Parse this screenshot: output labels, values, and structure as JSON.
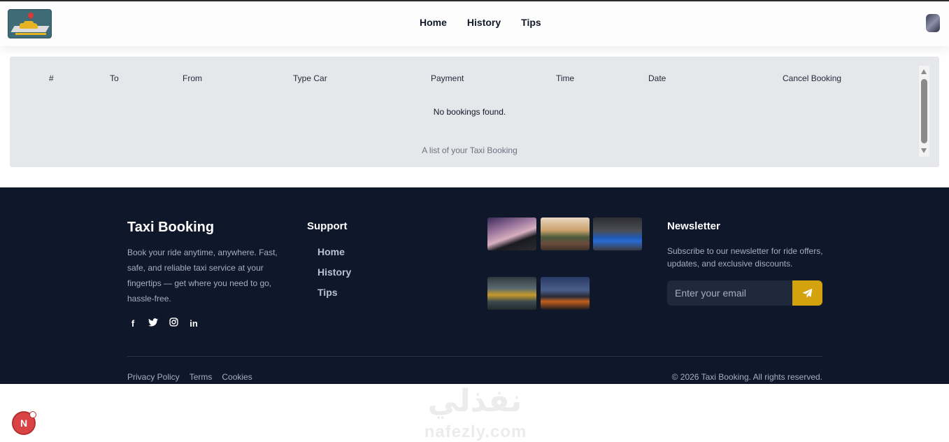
{
  "header": {
    "nav": [
      "Home",
      "History",
      "Tips"
    ]
  },
  "bookings_table": {
    "columns": [
      "#",
      "To",
      "From",
      "Type Car",
      "Payment",
      "Time",
      "Date",
      "Cancel Booking"
    ],
    "empty_message": "No bookings found.",
    "caption": "A list of your Taxi Booking"
  },
  "footer": {
    "brand": {
      "title": "Taxi Booking",
      "description": "Book your ride anytime, anywhere. Fast, safe, and reliable taxi service at your fingertips — get where you need to go, hassle-free.",
      "social_icons": [
        "facebook-icon",
        "twitter-icon",
        "instagram-icon",
        "linkedin-icon"
      ],
      "social_glyphs": [
        "f",
        "t",
        "◎",
        "in"
      ]
    },
    "support": {
      "title": "Support",
      "links": [
        "Home",
        "History",
        "Tips"
      ]
    },
    "gallery_count": 5,
    "newsletter": {
      "title": "Newsletter",
      "description": "Subscribe to our newsletter for ride offers, updates, and exclusive discounts.",
      "placeholder": "Enter your email",
      "button_color": "#d4a20c"
    },
    "legal_links": [
      "Privacy Policy",
      "Terms",
      "Cookies"
    ],
    "copyright": "© 2026 Taxi Booking. All rights reserved."
  },
  "watermark": {
    "arabic": "نفذلي",
    "latin": "nafezly.com"
  },
  "badge": {
    "letter": "N"
  },
  "colors": {
    "footer_bg": "#0f172a",
    "accent": "#d4a20c",
    "panel_bg": "#e6e7ea"
  }
}
